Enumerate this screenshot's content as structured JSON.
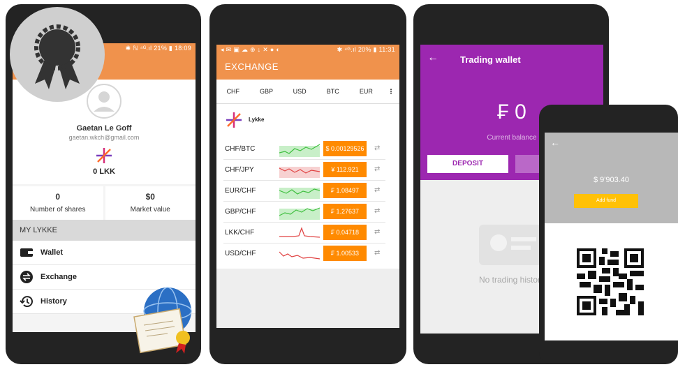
{
  "phone1": {
    "status": "✱ ℕ ⁴ᴳ.ıl 21% ▮ 18:09",
    "user_name": "Gaetan Le Goff",
    "user_email": "gaetan.wkch@gmail.com",
    "balance": "0 LKK",
    "stats": [
      {
        "value": "0",
        "label": "Number of shares"
      },
      {
        "value": "$0",
        "label": "Market value"
      }
    ],
    "section_title": "MY LYKKE",
    "menu": [
      {
        "label": "Wallet",
        "icon": "wallet-icon"
      },
      {
        "label": "Exchange",
        "icon": "exchange-icon"
      },
      {
        "label": "History",
        "icon": "history-icon"
      }
    ]
  },
  "phone2": {
    "status": "✱ ⁴ᴳ.ıl 20% ▮ 11:31",
    "title": "EXCHANGE",
    "tabs": [
      "CHF",
      "GBP",
      "USD",
      "BTC",
      "EUR"
    ],
    "brand": "Lykke",
    "rows": [
      {
        "pair": "CHF/BTC",
        "price": "$ 0.00129526",
        "trend": "green"
      },
      {
        "pair": "CHF/JPY",
        "price": "¥ 112.921",
        "trend": "red"
      },
      {
        "pair": "EUR/CHF",
        "price": "₣ 1.08497",
        "trend": "green"
      },
      {
        "pair": "GBP/CHF",
        "price": "₣ 1.27637",
        "trend": "green"
      },
      {
        "pair": "LKK/CHF",
        "price": "₣ 0.04718",
        "trend": "red"
      },
      {
        "pair": "USD/CHF",
        "price": "₣ 1.00533",
        "trend": "red"
      }
    ]
  },
  "phone3": {
    "title": "Trading wallet",
    "balance": "₣ 0",
    "balance_label": "Current balance",
    "deposit_label": "DEPOSIT",
    "withdraw_label": "W",
    "empty_text": "No trading history"
  },
  "phone4": {
    "amount": "$ 9'903.40",
    "add_fund_label": "Add fund"
  },
  "colors": {
    "orange": "#f0924c",
    "price_orange": "#ff8a00",
    "purple": "#9c27b0",
    "yellow": "#ffc107"
  }
}
